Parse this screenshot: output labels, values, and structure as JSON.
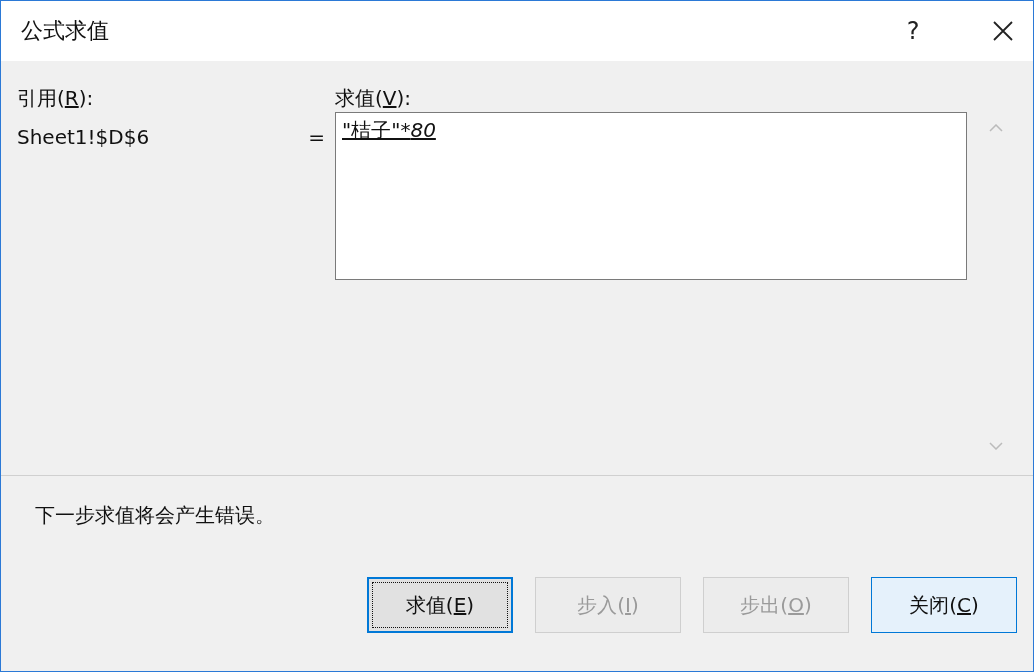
{
  "window": {
    "title": "公式求值",
    "help": "?"
  },
  "reference": {
    "label": {
      "before": "引用(",
      "key": "R",
      "after": "):"
    },
    "value": "Sheet1!$D$6",
    "equals": "="
  },
  "evaluation": {
    "label": {
      "before": "求值(",
      "key": "V",
      "after": "):"
    },
    "formula": [
      {
        "text": "\"桔子\"*",
        "italic": false
      },
      {
        "text": "80",
        "italic": true
      }
    ]
  },
  "message": "下一步求值将会产生错误。",
  "buttons": [
    {
      "label": {
        "before": "求值(",
        "key": "E",
        "after": ")"
      },
      "disabled": false,
      "focused": true
    },
    {
      "label": {
        "before": "步入(",
        "key": "I",
        "after": ")"
      },
      "disabled": true,
      "focused": false
    },
    {
      "label": {
        "before": "步出(",
        "key": "O",
        "after": ")"
      },
      "disabled": true,
      "focused": false
    },
    {
      "label": {
        "before": "关闭(",
        "key": "C",
        "after": ")"
      },
      "disabled": false,
      "focused": false
    }
  ]
}
